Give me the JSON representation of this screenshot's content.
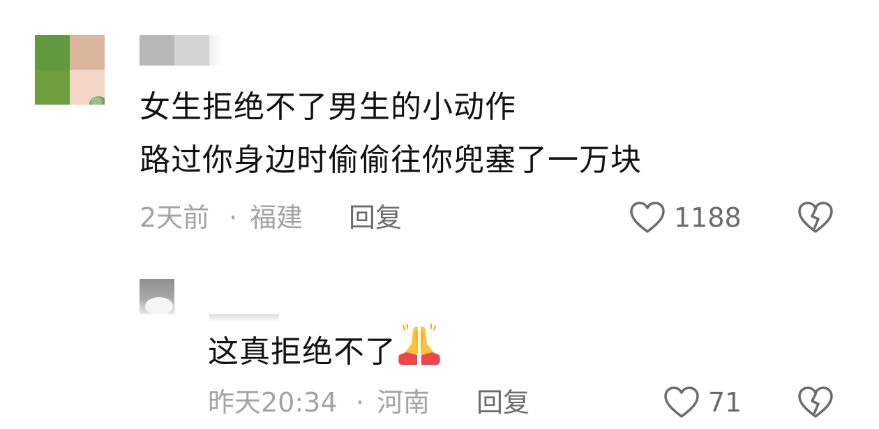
{
  "comments": [
    {
      "lines": [
        "女生拒绝不了男生的小动作",
        "路过你身边时偷偷往你兜塞了一万块"
      ],
      "time": "2天前",
      "separator": "·",
      "location": "福建",
      "reply_label": "回复",
      "likes": "1188",
      "icons": {
        "like": "heart-outline-icon",
        "dislike": "broken-heart-icon"
      }
    }
  ],
  "reply": {
    "text": "这真拒绝不了",
    "emoji": "folded-hands-emoji",
    "time": "昨天20:34",
    "separator": "·",
    "location": "河南",
    "reply_label": "回复",
    "likes": "71",
    "icons": {
      "like": "heart-outline-icon",
      "dislike": "broken-heart-icon"
    }
  },
  "colors": {
    "text": "#111111",
    "meta": "#a3a3a3",
    "action": "#6b6b6b",
    "emoji_yellow": "#fcc23d",
    "emoji_red": "#f2454a"
  }
}
